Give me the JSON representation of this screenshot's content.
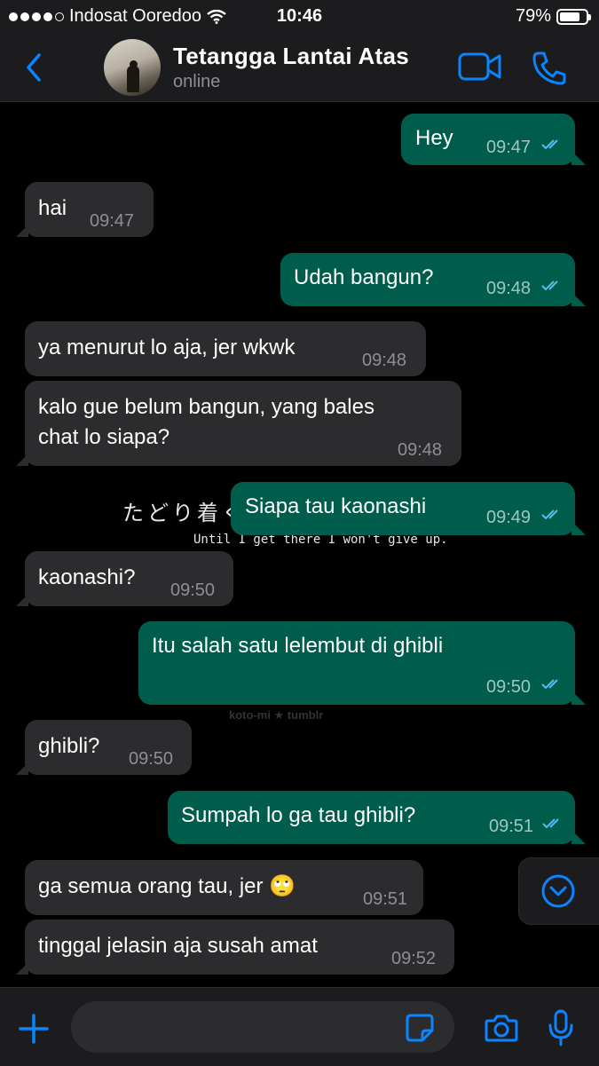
{
  "status_bar": {
    "carrier": "Indosat Ooredoo",
    "time": "10:46",
    "battery": "79%",
    "battery_level": 0.79,
    "signal_icon": "signal-dots-icon",
    "wifi_icon": "wifi-icon"
  },
  "header": {
    "contact_name": "Tetangga Lantai Atas",
    "status": "online",
    "accent_color": "#0a84ff"
  },
  "messages": [
    {
      "dir": "out",
      "text": "Hey",
      "time": "09:47",
      "read": true
    },
    {
      "dir": "in",
      "text": "hai",
      "time": "09:47"
    },
    {
      "dir": "out",
      "text": "Udah bangun?",
      "time": "09:48",
      "read": true
    },
    {
      "dir": "in",
      "text": "ya menurut lo aja, jer wkwk",
      "time": "09:48"
    },
    {
      "dir": "in",
      "text_line1": "kalo gue belum bangun, yang bales",
      "text_line2": "chat lo siapa?",
      "time": "09:48"
    },
    {
      "dir": "out",
      "text": "Siapa tau kaonashi",
      "time": "09:49",
      "read": true
    },
    {
      "dir": "in",
      "text": "kaonashi?",
      "time": "09:50"
    },
    {
      "dir": "out",
      "text": "Itu salah satu lelembut di ghibli",
      "time": "09:50",
      "read": true
    },
    {
      "dir": "in",
      "text": "ghibli?",
      "time": "09:50"
    },
    {
      "dir": "out",
      "text": "Sumpah lo ga tau ghibli?",
      "time": "09:51",
      "read": true
    },
    {
      "dir": "in",
      "text": "ga semua orang tau, jer 🙄",
      "time": "09:51"
    },
    {
      "dir": "in",
      "text": "tinggal jelasin aja susah amat",
      "time": "09:52"
    }
  ],
  "watermarks": {
    "japanese": "たどり着く",
    "english": "Until I get there I won't give up.",
    "tumblr": "koto-mi ★ tumblr"
  },
  "input": {
    "value": "",
    "placeholder": ""
  },
  "colors": {
    "incoming_bubble": "#2c2c2e",
    "outgoing_bubble": "#005c4b",
    "read_ticks": "#53bdeb"
  }
}
